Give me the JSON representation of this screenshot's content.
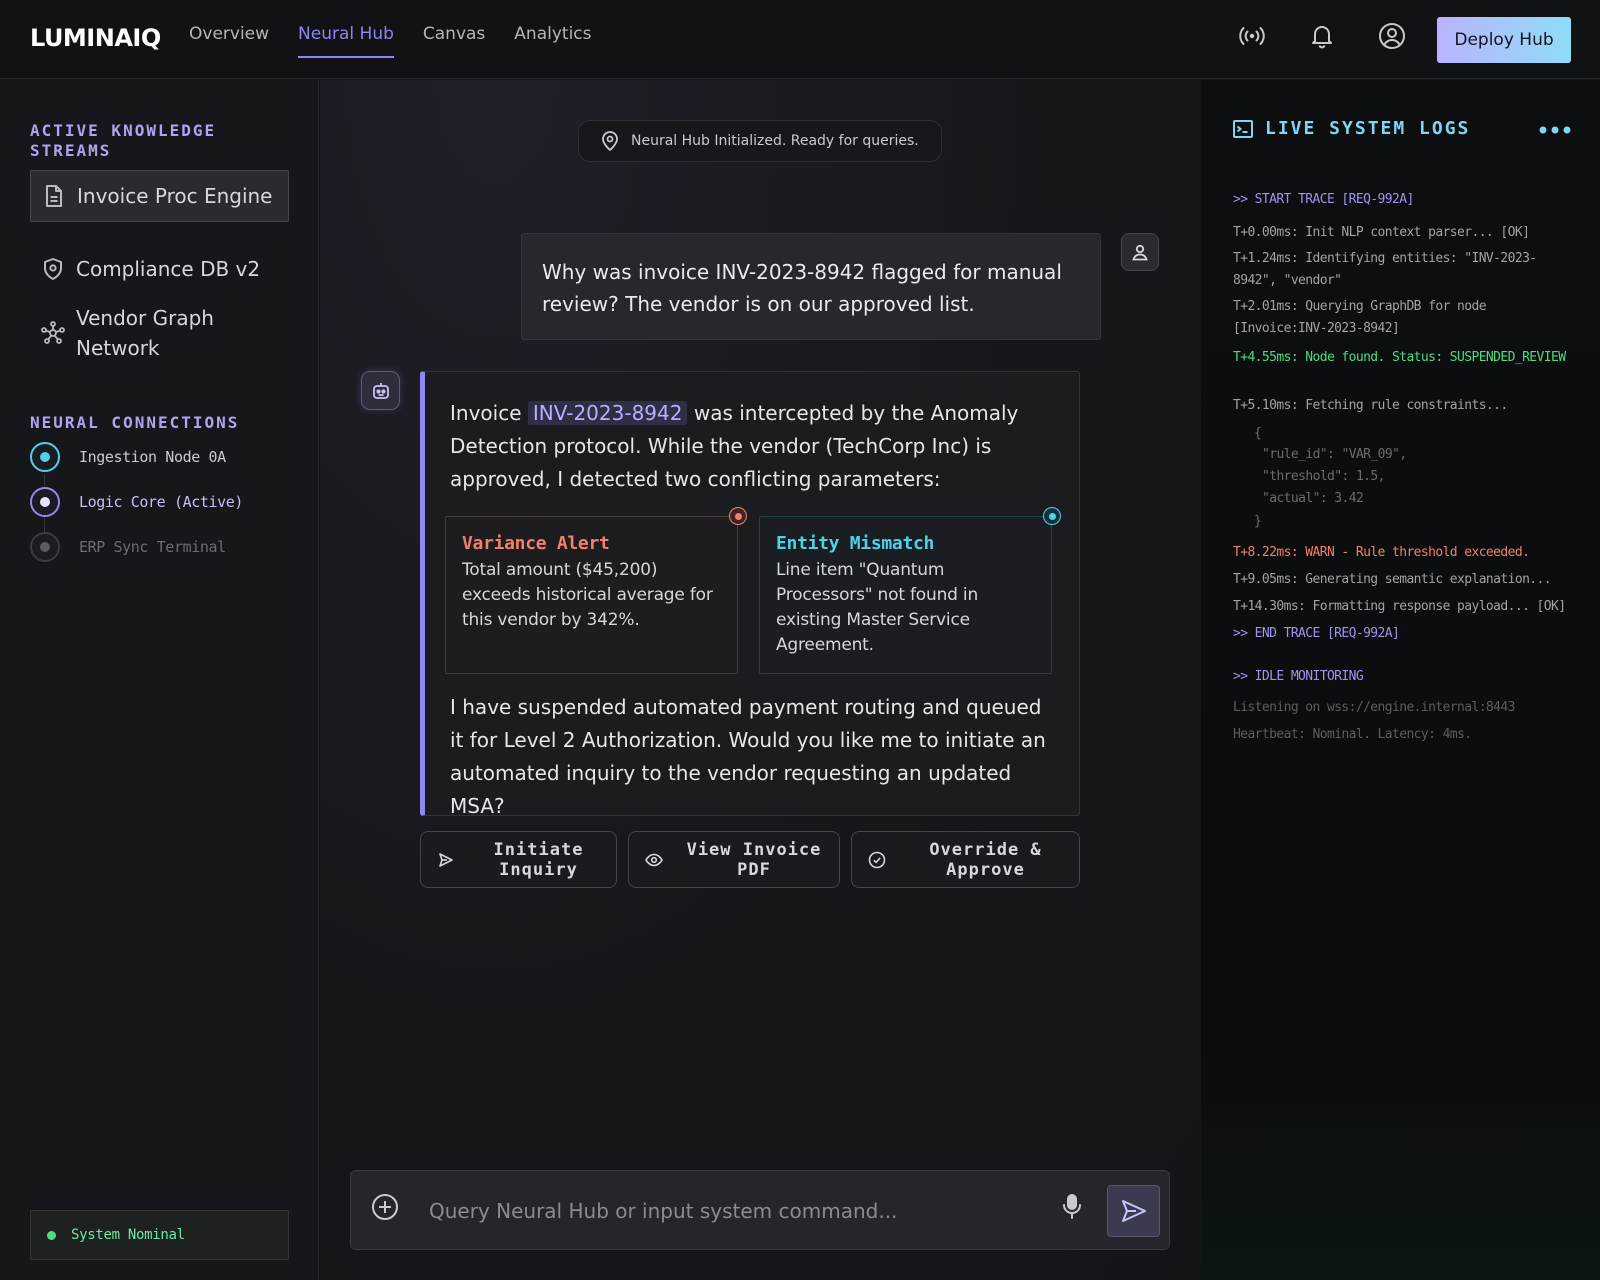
{
  "brand": "LUMINAIQ",
  "nav": {
    "items": [
      "Overview",
      "Neural Hub",
      "Canvas",
      "Analytics"
    ],
    "active": "Neural Hub"
  },
  "header_actions": {
    "deploy_label": "Deploy Hub",
    "icons": [
      "broadcast-icon",
      "bell-icon",
      "user-circle-icon"
    ]
  },
  "sidebar": {
    "streams_title": "ACTIVE KNOWLEDGE STREAMS",
    "streams": [
      {
        "label": "Invoice Proc Engine",
        "icon": "document-icon",
        "active": true
      },
      {
        "label": "Compliance DB v2",
        "icon": "shield-icon",
        "active": false
      },
      {
        "label": "Vendor Graph Network",
        "icon": "network-icon",
        "active": false
      }
    ],
    "connections_title": "NEURAL CONNECTIONS",
    "connections": [
      {
        "label": "Ingestion Node 0A",
        "state": "online",
        "color": "#4fd1e8"
      },
      {
        "label": "Logic Core (Active)",
        "state": "active",
        "color": "#c9c6ff"
      },
      {
        "label": "ERP Sync Terminal",
        "state": "offline",
        "color": "#5b5c64"
      }
    ],
    "status": "System Nominal"
  },
  "chat": {
    "init_message": "Neural Hub Initialized. Ready for queries.",
    "user_message": "Why was invoice INV-2023-8942 flagged for manual review? The vendor is on our approved list.",
    "bot": {
      "intro_before": "Invoice",
      "invoice_id": "INV-2023-8942",
      "intro_after": "was intercepted by the Anomaly Detection protocol. While the vendor (TechCorp Inc) is approved, I detected two conflicting parameters:",
      "cards": [
        {
          "title": "Variance Alert",
          "body": "Total amount ($45,200) exceeds historical average for this vendor by 342%.",
          "color": "#f2806a"
        },
        {
          "title": "Entity Mismatch",
          "body": "Line item \"Quantum Processors\" not found in existing Master Service Agreement.",
          "color": "#4fd1e8"
        }
      ],
      "outro": "I have suspended automated payment routing and queued it for Level 2 Authorization. Would you like me to initiate an automated inquiry to the vendor requesting an updated MSA?"
    },
    "actions": [
      {
        "label": "Initiate Inquiry",
        "icon": "send-icon"
      },
      {
        "label": "View Invoice PDF",
        "icon": "eye-icon"
      },
      {
        "label": "Override & Approve",
        "icon": "check-circle-icon"
      }
    ],
    "input_placeholder": "Query Neural Hub or input system command..."
  },
  "logs": {
    "title": "LIVE SYSTEM LOGS",
    "lines": [
      {
        "text": ">> START TRACE [REQ-992A]",
        "kind": "trace"
      },
      {
        "text": "T+0.00ms: Init NLP context parser... [OK]",
        "kind": "info"
      },
      {
        "text": "T+1.24ms: Identifying entities: \"INV-2023-8942\", \"vendor\"",
        "kind": "info"
      },
      {
        "text": "T+2.01ms: Querying GraphDB for node [Invoice:INV-2023-8942]",
        "kind": "info"
      },
      {
        "text": "T+4.55ms: Node found. Status: SUSPENDED_REVIEW",
        "kind": "ok"
      },
      {
        "text": "T+5.10ms: Fetching rule constraints...",
        "kind": "info"
      },
      {
        "text": "{",
        "kind": "json"
      },
      {
        "text": "\"rule_id\": \"VAR_09\",",
        "kind": "json"
      },
      {
        "text": "\"threshold\": 1.5,",
        "kind": "json"
      },
      {
        "text": "\"actual\": 3.42",
        "kind": "json"
      },
      {
        "text": "}",
        "kind": "json"
      },
      {
        "text": "T+8.22ms: WARN - Rule threshold exceeded.",
        "kind": "warn"
      },
      {
        "text": "T+9.05ms: Generating semantic explanation...",
        "kind": "info"
      },
      {
        "text": "T+14.30ms: Formatting response payload... [OK]",
        "kind": "info"
      },
      {
        "text": ">> END TRACE [REQ-992A]",
        "kind": "trace"
      },
      {
        "text": ">> IDLE MONITORING",
        "kind": "trace"
      },
      {
        "text": "Listening on wss://engine.internal:8443",
        "kind": "dim"
      },
      {
        "text": "Heartbeat: Nominal. Latency: 4ms.",
        "kind": "dim"
      }
    ]
  }
}
